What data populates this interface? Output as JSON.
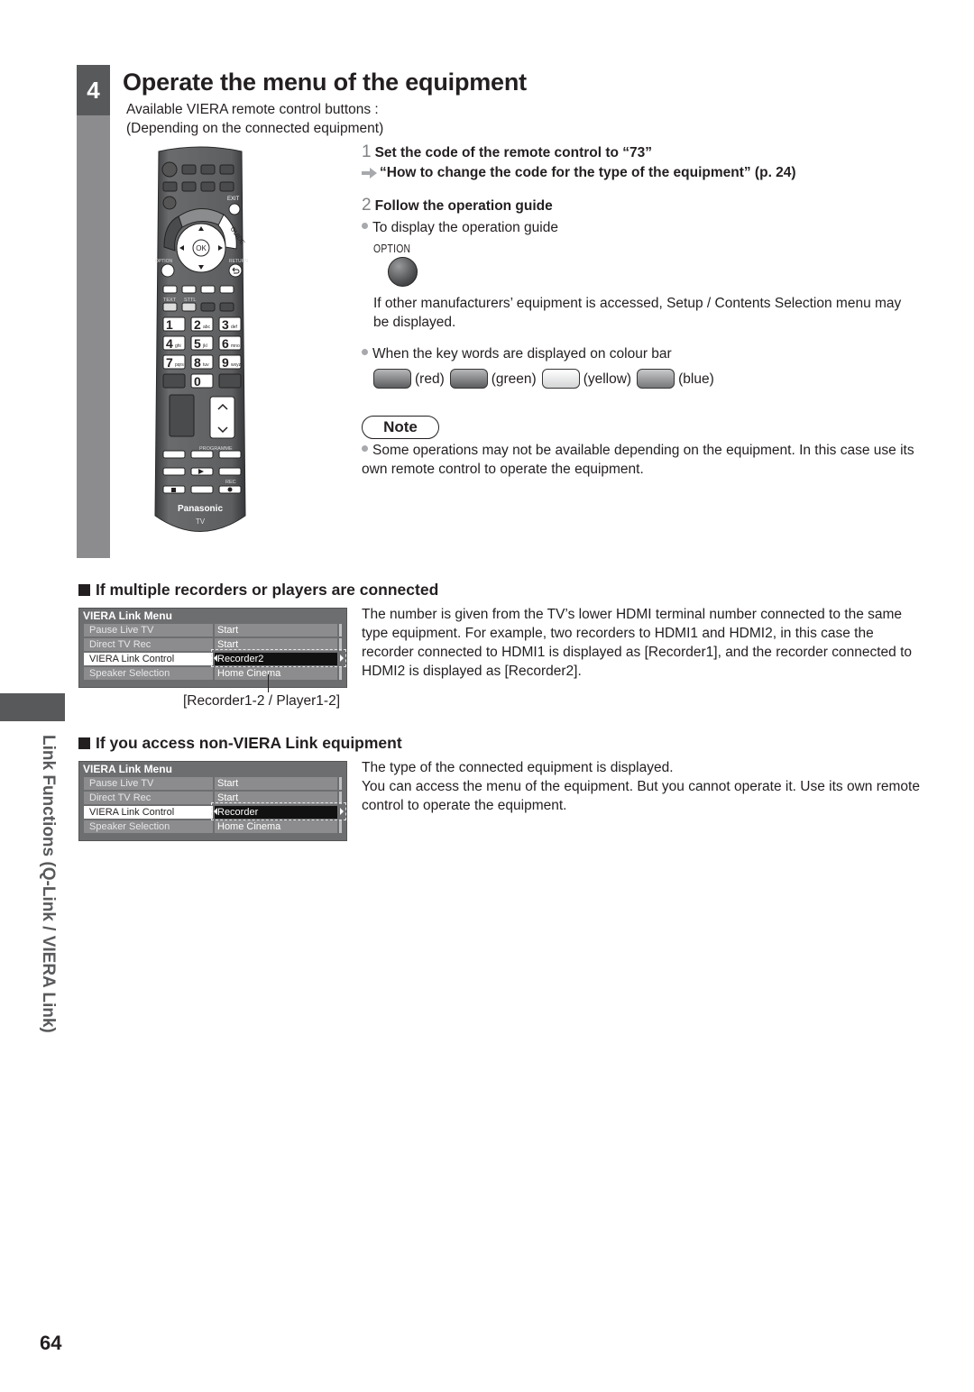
{
  "step": {
    "number": "4",
    "title": "Operate the menu of the equipment",
    "intro_line1": "Available VIERA remote control buttons :",
    "intro_line2": "(Depending on the connected equipment)"
  },
  "remote": {
    "exit_label": "EXIT",
    "guide_label": "GUIDE",
    "ok_label": "OK",
    "option_label": "OPTION",
    "return_label": "RETURN",
    "text_label": "TEXT",
    "sttl_label": "STTL",
    "digits": [
      "1",
      "2",
      "3",
      "4",
      "5",
      "6",
      "7",
      "8",
      "9",
      "0"
    ],
    "digit_letters": [
      "",
      "abc",
      "def",
      "ghi",
      "jkl",
      "mno",
      "pqrs",
      "tuv",
      "wxyz",
      ""
    ],
    "programme_label": "PROGRAMME",
    "rec_label": "REC",
    "brand": "Panasonic",
    "model": "TV"
  },
  "instructions": {
    "step1_num": "1",
    "step1_title": "Set the code of the remote control to “73”",
    "step1_ref": "“How to change the code for the type of the equipment” (p. 24)",
    "step2_num": "2",
    "step2_title": "Follow the operation guide",
    "bullet1": "To display the operation guide",
    "option_button_label": "OPTION",
    "other_mfr_text": "If other manufacturers’ equipment is accessed, Setup / Contents Selection menu may be displayed.",
    "bullet2": "When the key words are displayed on colour bar",
    "colour_keys": [
      {
        "label": "(red)",
        "style": "dark"
      },
      {
        "label": "(green)",
        "style": "dark"
      },
      {
        "label": "(yellow)",
        "style": "light"
      },
      {
        "label": "(blue)",
        "style": "mid"
      }
    ]
  },
  "note": {
    "title": "Note",
    "text": "Some operations may not be available depending on the equipment. In this case use its own remote control to operate the equipment."
  },
  "section_multi": {
    "heading": "If multiple recorders or players are connected",
    "menu": {
      "title": "VIERA Link Menu",
      "rows": [
        {
          "label": "Pause Live TV",
          "value": "Start"
        },
        {
          "label": "Direct TV Rec",
          "value": "Start"
        },
        {
          "label": "VIERA Link Control",
          "value": "Recorder2",
          "selected": true
        },
        {
          "label": "Speaker Selection",
          "value": "Home Cinema"
        }
      ]
    },
    "callout": "[Recorder1-2 / Player1-2]",
    "description": "The number is given from the TV’s lower HDMI terminal number connected to the same type equipment. For example, two recorders to HDMI1 and HDMI2, in this case the recorder connected to HDMI1 is displayed as [Recorder1], and the recorder connected to HDMI2 is displayed as [Recorder2]."
  },
  "section_nonviera": {
    "heading": "If you access non-VIERA Link equipment",
    "menu": {
      "title": "VIERA Link Menu",
      "rows": [
        {
          "label": "Pause Live TV",
          "value": "Start"
        },
        {
          "label": "Direct TV Rec",
          "value": "Start"
        },
        {
          "label": "VIERA Link Control",
          "value": "Recorder",
          "selected": true
        },
        {
          "label": "Speaker Selection",
          "value": "Home Cinema"
        }
      ]
    },
    "description_line1": "The type of the connected equipment is displayed.",
    "description_line2": "You can access the menu of the equipment. But you cannot operate it. Use its own remote control to operate the equipment."
  },
  "side_tab": {
    "label": "Link Functions (Q-Link / VIERA Link)"
  },
  "page_number": "64"
}
